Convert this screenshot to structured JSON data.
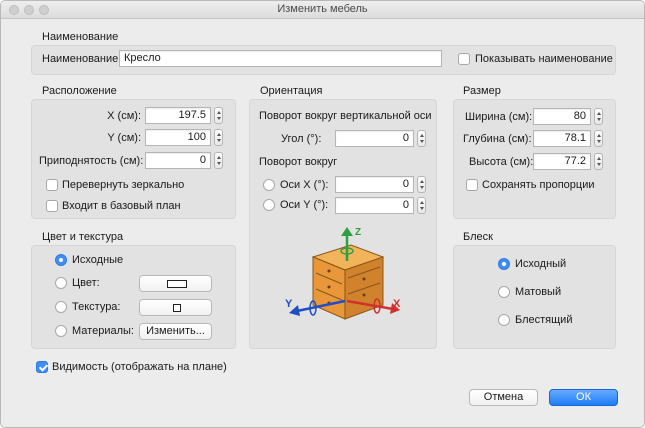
{
  "window": {
    "title": "Изменить мебель"
  },
  "name_section": {
    "title": "Наименование",
    "name_label": "Наименование:",
    "name_value": "Кресло",
    "show_name_label": "Показывать наименование",
    "show_name_checked": false
  },
  "location": {
    "title": "Расположение",
    "x_label": "X (см):",
    "x_value": "197.5",
    "y_label": "Y (см):",
    "y_value": "100",
    "elevation_label": "Приподнятость (см):",
    "elevation_value": "0",
    "mirror_label": "Перевернуть зеркально",
    "mirror_checked": false,
    "base_plan_label": "Входит в базовый план",
    "base_plan_checked": false
  },
  "orientation": {
    "title": "Ориентация",
    "vertical_axis_label": "Поворот вокруг вертикальной оси",
    "angle_label": "Угол (°):",
    "angle_value": "0",
    "rotate_around_label": "Поворот вокруг",
    "axis_x_label": "Оси X (°):",
    "axis_x_value": "0",
    "axis_y_label": "Оси Y (°):",
    "axis_y_value": "0",
    "illustration_axes": {
      "x": "X",
      "y": "Y",
      "z": "Z"
    }
  },
  "size": {
    "title": "Размер",
    "width_label": "Ширина (см):",
    "width_value": "80",
    "depth_label": "Глубина (см):",
    "depth_value": "78.1",
    "height_label": "Высота (см):",
    "height_value": "77.2",
    "keep_proportions_label": "Сохранять пропорции",
    "keep_proportions_checked": false
  },
  "color_texture": {
    "title": "Цвет и текстура",
    "options": [
      "Исходные",
      "Цвет:",
      "Текстура:",
      "Материалы:"
    ],
    "selected": "Исходные",
    "materials_button": "Изменить..."
  },
  "shininess": {
    "title": "Блеск",
    "options": [
      "Исходный",
      "Матовый",
      "Блестящий"
    ],
    "selected": "Исходный"
  },
  "visibility": {
    "label": "Видимость (отображать на плане)",
    "checked": true
  },
  "buttons": {
    "cancel": "Отмена",
    "ok": "ОК"
  },
  "colors": {
    "accent": "#3d8ef7",
    "axis_x": "#d0312d",
    "axis_y": "#1f4fc4",
    "axis_z": "#2ea043",
    "furniture": "#e59a3a"
  }
}
